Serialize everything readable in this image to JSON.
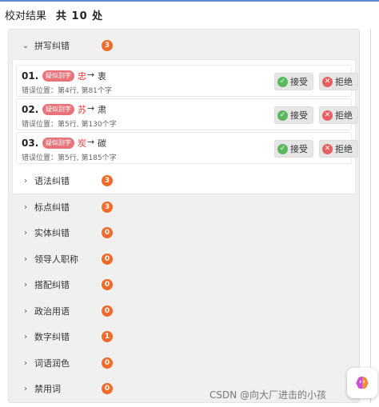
{
  "header": {
    "title": "校对结果",
    "total": "共 10 处"
  },
  "sections": [
    {
      "label": "拼写纠错",
      "count": "3",
      "expanded": true
    },
    {
      "label": "语法纠错",
      "count": "3"
    },
    {
      "label": "标点纠错",
      "count": "3"
    },
    {
      "label": "实体纠错",
      "count": "0"
    },
    {
      "label": "领导人职称",
      "count": "0"
    },
    {
      "label": "搭配纠错",
      "count": "0"
    },
    {
      "label": "政治用语",
      "count": "0"
    },
    {
      "label": "数字纠错",
      "count": "1"
    },
    {
      "label": "词语润色",
      "count": "0"
    },
    {
      "label": "禁用词",
      "count": "0"
    }
  ],
  "items": [
    {
      "num": "01.",
      "tag": "疑似别字",
      "original": "忠",
      "arrow": "→",
      "suggestion": "衷",
      "position": "错误位置：第4行, 第81个字",
      "accept": "接受",
      "reject": "拒绝"
    },
    {
      "num": "02.",
      "tag": "疑似别字",
      "original": "苏",
      "arrow": "→",
      "suggestion": "肃",
      "position": "错误位置：第5行, 第130个字",
      "accept": "接受",
      "reject": "拒绝"
    },
    {
      "num": "03.",
      "tag": "疑似别字",
      "original": "炭",
      "arrow": "→",
      "suggestion": "碳",
      "position": "错误位置：第5行, 第185个字",
      "accept": "接受",
      "reject": "拒绝"
    }
  ],
  "icons": {
    "collapsed": "chevron-right-icon",
    "expanded": "chevron-down-icon",
    "accept": "check-circle-icon",
    "reject": "close-circle-icon",
    "assistant": "brain-icon"
  },
  "colors": {
    "badge": "#f06a2a",
    "tag": "#e8737a",
    "error_char": "#e23b3b",
    "accept_icon": "#5cb85c",
    "reject_icon": "#e95f5f"
  },
  "watermark": "CSDN @向大厂进击的小孩"
}
